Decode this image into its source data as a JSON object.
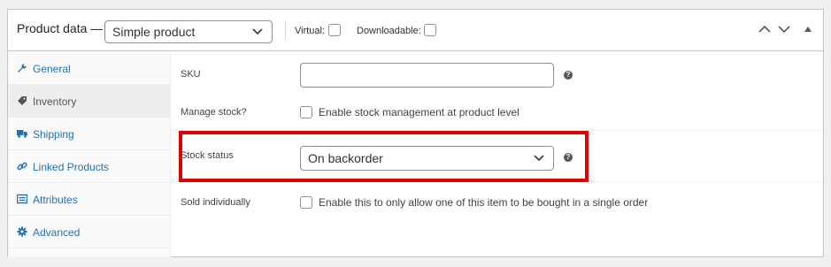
{
  "header": {
    "title": "Product data —",
    "product_type": "Simple product",
    "virtual_label": "Virtual:",
    "downloadable_label": "Downloadable:"
  },
  "tabs": [
    {
      "label": "General",
      "icon": "wrench-icon"
    },
    {
      "label": "Inventory",
      "icon": "tag-icon"
    },
    {
      "label": "Shipping",
      "icon": "truck-icon"
    },
    {
      "label": "Linked Products",
      "icon": "link-icon"
    },
    {
      "label": "Attributes",
      "icon": "list-icon"
    },
    {
      "label": "Advanced",
      "icon": "gear-icon"
    }
  ],
  "active_tab": "Inventory",
  "fields": {
    "sku": {
      "label": "SKU",
      "value": ""
    },
    "manage_stock": {
      "label": "Manage stock?",
      "text": "Enable stock management at product level",
      "checked": false
    },
    "stock_status": {
      "label": "Stock status",
      "value": "On backorder"
    },
    "sold_individually": {
      "label": "Sold individually",
      "text": "Enable this to only allow one of this item to be bought in a single order",
      "checked": false
    }
  },
  "help_glyph": "?",
  "colors": {
    "link": "#2271b1",
    "highlight": "#e00000",
    "border": "#c3c4c7"
  }
}
